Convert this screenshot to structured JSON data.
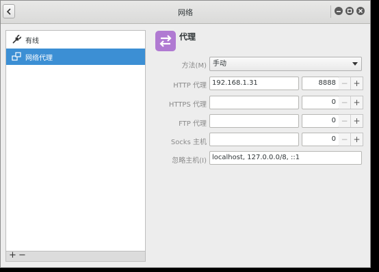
{
  "window": {
    "title": "网络"
  },
  "sidebar": {
    "items": [
      {
        "label": "有线",
        "icon": "wired-icon"
      },
      {
        "label": "网络代理",
        "icon": "network-proxy-icon",
        "selected": true
      }
    ],
    "footer": {
      "add": "+",
      "remove": "−"
    }
  },
  "proxy": {
    "heading": "代理",
    "method": {
      "label": "方法(M)",
      "value": "手动"
    },
    "http": {
      "label": "HTTP 代理",
      "host": "192.168.1.31",
      "port": "8888"
    },
    "https": {
      "label": "HTTPS 代理",
      "host": "",
      "port": "0"
    },
    "ftp": {
      "label": "FTP 代理",
      "host": "",
      "port": "0"
    },
    "socks": {
      "label": "Socks 主机",
      "host": "",
      "port": "0"
    },
    "ignore": {
      "label": "忽略主机(I)",
      "value": "localhost, 127.0.0.0/8, ::1"
    },
    "stepper": {
      "minus": "−",
      "plus": "+"
    }
  },
  "colors": {
    "accent": "#3c8fd4",
    "proxy_icon": "#b07ad2"
  }
}
